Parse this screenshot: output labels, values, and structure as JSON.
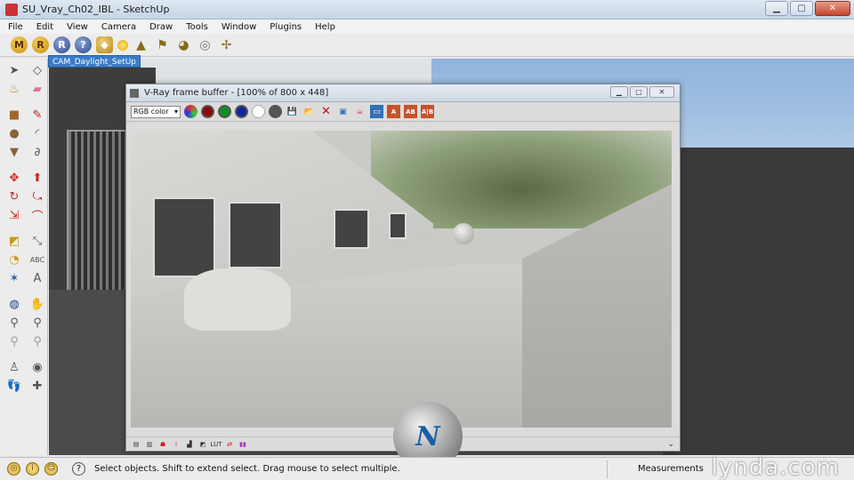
{
  "window": {
    "title": "SU_Vray_Ch02_IBL - SketchUp",
    "minimize": "▁",
    "maximize": "▢",
    "close": "✕"
  },
  "menu": [
    "File",
    "Edit",
    "View",
    "Camera",
    "Draw",
    "Tools",
    "Window",
    "Plugins",
    "Help"
  ],
  "toolbar": {
    "icons": [
      "m-icon",
      "r-icon",
      "r-blue-icon",
      "help-icon",
      "tag-icon",
      "sun-icon",
      "lamp-icon",
      "flag-icon",
      "dome-light-icon",
      "sphere-icon",
      "dragonfly-icon"
    ],
    "glyphs": {
      "m": "M",
      "r1": "R",
      "r2": "R",
      "q": "?"
    }
  },
  "scene_tab": {
    "label": "CAM_Daylight_SetUp"
  },
  "palette": {
    "icons": [
      "select-icon",
      "component-icon",
      "paint-bucket-icon",
      "eraser-icon",
      "rectangle-icon",
      "line-icon",
      "circle-icon",
      "arc-icon",
      "polygon-icon",
      "freehand-icon",
      "move-icon",
      "push-pull-icon",
      "rotate-icon",
      "follow-me-icon",
      "scale-icon",
      "offset-icon",
      "tape-measure-icon",
      "dimension-icon",
      "protractor-icon",
      "text-icon",
      "axes-icon",
      "3d-text-icon",
      "orbit-icon",
      "pan-icon",
      "zoom-icon",
      "zoom-window-icon",
      "previous-icon",
      "next-icon",
      "position-camera-icon",
      "look-around-icon",
      "walk-icon",
      "section-plane-icon"
    ]
  },
  "vfb": {
    "title": "V-Ray frame buffer - [100% of 800 x 448]",
    "channel": "RGB color",
    "minimize": "▁",
    "maximize": "▢",
    "close": "✕",
    "toolbar": [
      "rgb-channel-icon",
      "red-channel-icon",
      "green-channel-icon",
      "blue-channel-icon",
      "alpha-channel-icon",
      "mono-channel-icon",
      "save-icon",
      "open-icon",
      "clear-icon",
      "track-mouse-icon",
      "copy-vfb-icon",
      "region-render-icon",
      "compare-a-icon",
      "compare-b-icon",
      "compare-ab-icon"
    ],
    "status_icons": [
      "display-colors-icon",
      "stereo-icon",
      "red-info-icon",
      "info-icon",
      "color-corrections-icon",
      "levels-icon",
      "lut-icon",
      "curve-icon",
      "exposure-icon"
    ]
  },
  "status": {
    "message": "Select objects. Shift to extend select. Drag mouse to select multiple.",
    "measurements_label": "Measurements"
  },
  "watermark": {
    "lynda": "lynda.com",
    "logo": "N"
  }
}
